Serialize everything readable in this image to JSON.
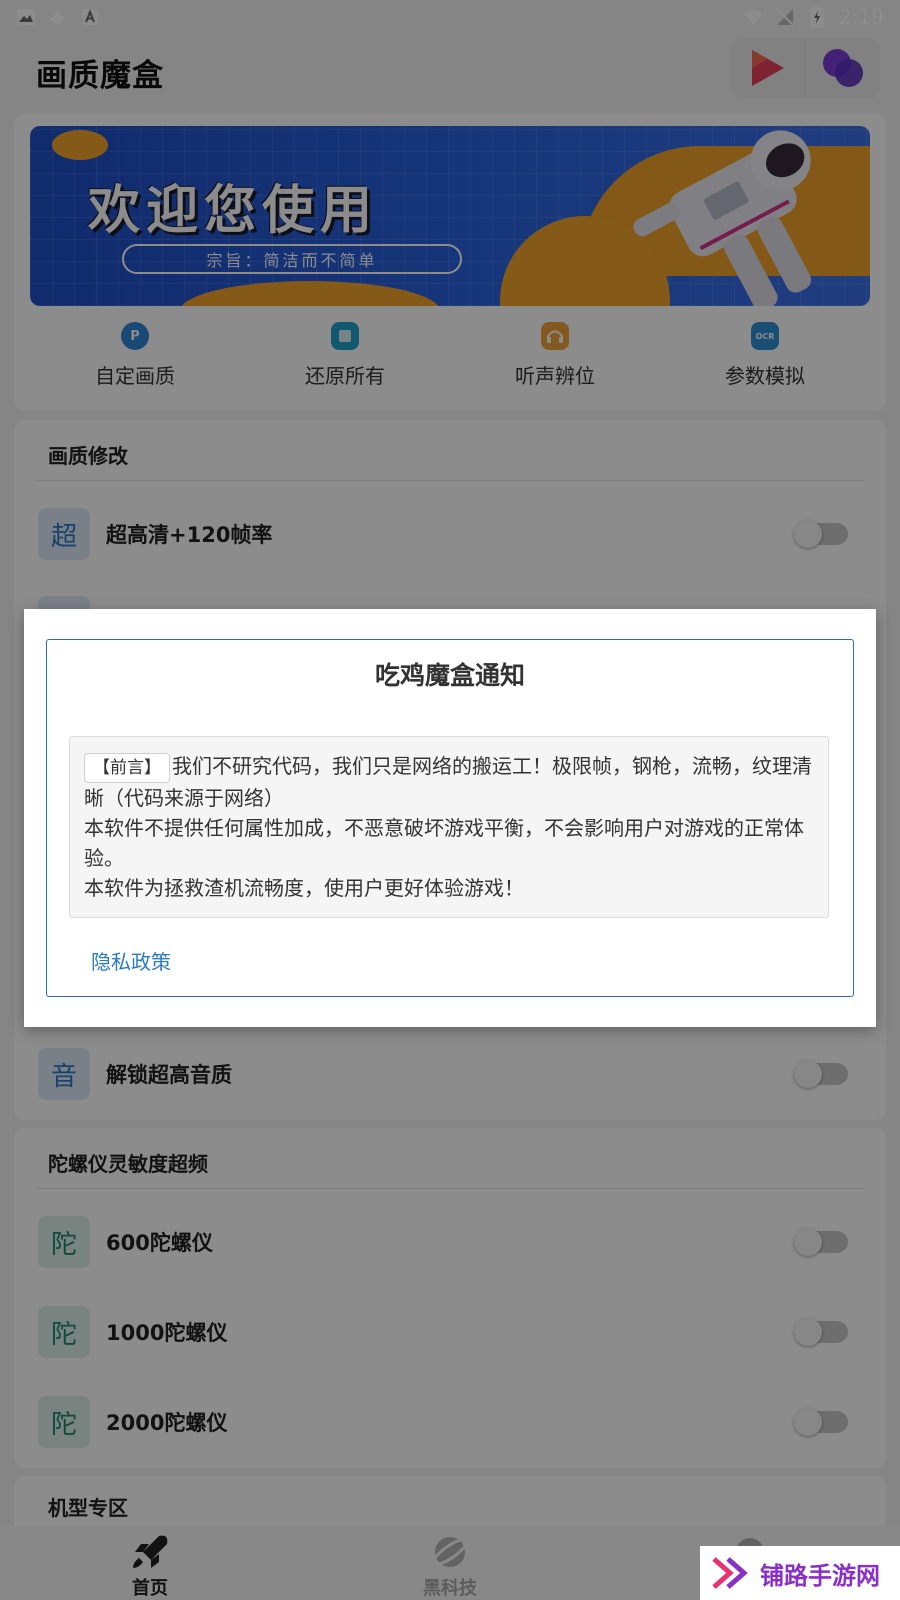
{
  "status_bar": {
    "time": "2:19"
  },
  "app": {
    "title": "画质魔盒"
  },
  "banner": {
    "headline": "欢迎您使用",
    "tagline": "宗旨：简洁而不简单"
  },
  "quick_actions": [
    {
      "label": "自定画质",
      "icon": "p-icon",
      "color": "#2f86d6",
      "glyph": "P"
    },
    {
      "label": "还原所有",
      "icon": "restore-icon",
      "color": "#1fa3c9",
      "glyph": ""
    },
    {
      "label": "听声辨位",
      "icon": "headphone-icon",
      "color": "#f0a23a",
      "glyph": ""
    },
    {
      "label": "参数模拟",
      "icon": "ocr-icon",
      "color": "#2f8fd6",
      "glyph": "OCR"
    }
  ],
  "section_quality": {
    "title": "画质修改",
    "rows": [
      {
        "badge": "超",
        "label": "超高清+120帧率",
        "enabled": false
      }
    ],
    "audio_row": {
      "badge": "音",
      "label": "解锁超高音质",
      "enabled": false
    }
  },
  "section_gyro": {
    "title": "陀螺仪灵敏度超频",
    "rows": [
      {
        "badge": "陀",
        "label": "600陀螺仪",
        "enabled": false
      },
      {
        "badge": "陀",
        "label": "1000陀螺仪",
        "enabled": false
      },
      {
        "badge": "陀",
        "label": "2000陀螺仪",
        "enabled": false
      }
    ]
  },
  "section_models": {
    "title": "机型专区"
  },
  "bottom_nav": [
    {
      "label": "首页",
      "icon": "rocket-icon",
      "active": true
    },
    {
      "label": "黑科技",
      "icon": "planet-icon",
      "active": false
    },
    {
      "label": "",
      "icon": "settings-icon",
      "active": false
    }
  ],
  "watermark": {
    "text": "铺路手游网"
  },
  "dialog": {
    "title": "吃鸡魔盒通知",
    "tag": "【前言】",
    "line1": "我们不研究代码，我们只是网络的搬运工！极限帧，钢枪，流畅，纹理清晰（代码来源于网络）",
    "line2": "本软件不提供任何属性加成，不恶意破坏游戏平衡，不会影响用户对游戏的正常体验。",
    "line3": "本软件为拯救渣机流畅度，使用户更好体验游戏！",
    "privacy_link": "隐私政策"
  }
}
